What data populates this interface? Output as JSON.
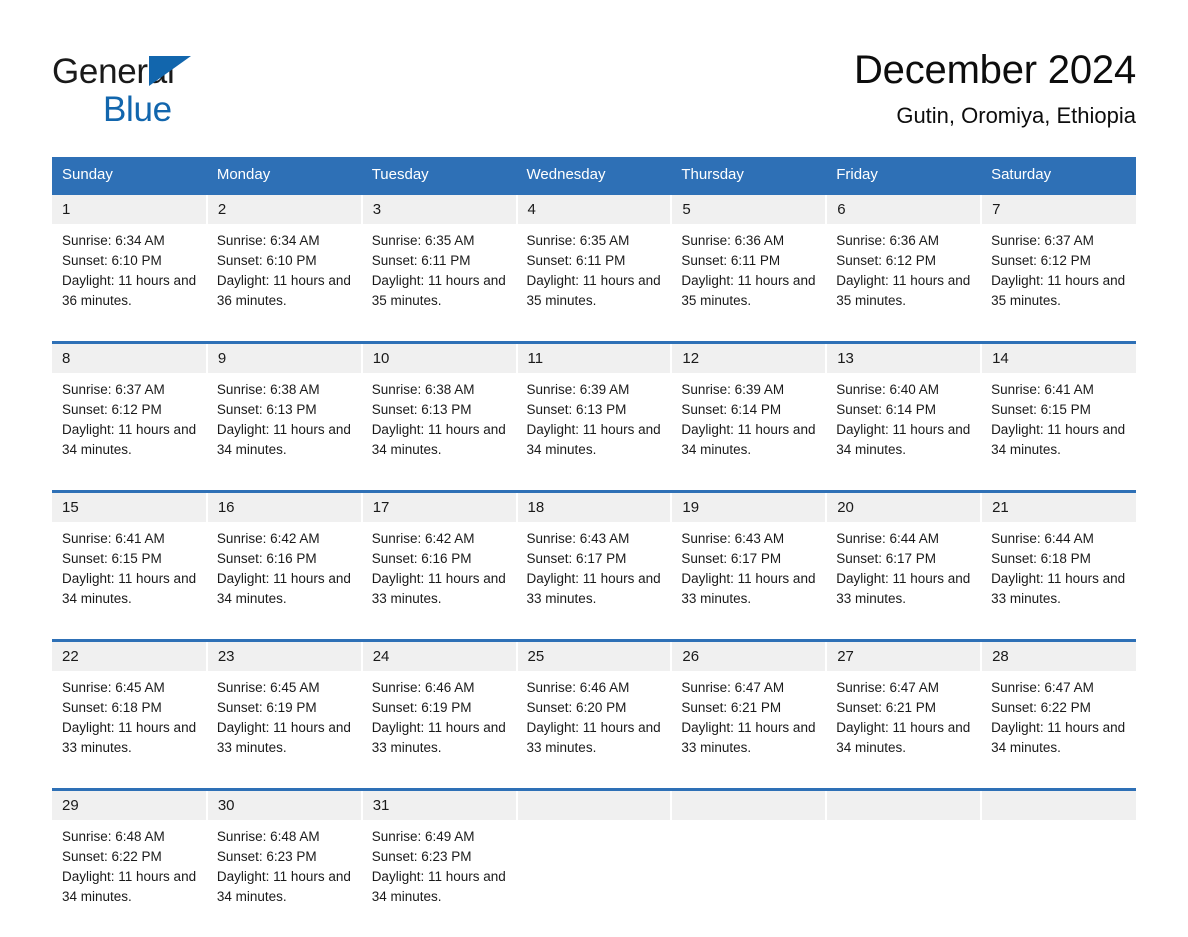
{
  "brand": {
    "name_part1": "General",
    "name_part2": "Blue",
    "triangle_color": "#1266ad",
    "blue_color": "#1266ad"
  },
  "header": {
    "title": "December 2024",
    "subtitle": "Gutin, Oromiya, Ethiopia"
  },
  "theme": {
    "header_blue": "#2e70b6",
    "row_rule_blue": "#2e70b6",
    "daynum_band": "#f0f0f0",
    "cell_background": "#ffffff"
  },
  "weekdays": [
    "Sunday",
    "Monday",
    "Tuesday",
    "Wednesday",
    "Thursday",
    "Friday",
    "Saturday"
  ],
  "weeks": [
    [
      {
        "day": "1",
        "sunrise": "Sunrise: 6:34 AM",
        "sunset": "Sunset: 6:10 PM",
        "daylight": "Daylight: 11 hours and 36 minutes."
      },
      {
        "day": "2",
        "sunrise": "Sunrise: 6:34 AM",
        "sunset": "Sunset: 6:10 PM",
        "daylight": "Daylight: 11 hours and 36 minutes."
      },
      {
        "day": "3",
        "sunrise": "Sunrise: 6:35 AM",
        "sunset": "Sunset: 6:11 PM",
        "daylight": "Daylight: 11 hours and 35 minutes."
      },
      {
        "day": "4",
        "sunrise": "Sunrise: 6:35 AM",
        "sunset": "Sunset: 6:11 PM",
        "daylight": "Daylight: 11 hours and 35 minutes."
      },
      {
        "day": "5",
        "sunrise": "Sunrise: 6:36 AM",
        "sunset": "Sunset: 6:11 PM",
        "daylight": "Daylight: 11 hours and 35 minutes."
      },
      {
        "day": "6",
        "sunrise": "Sunrise: 6:36 AM",
        "sunset": "Sunset: 6:12 PM",
        "daylight": "Daylight: 11 hours and 35 minutes."
      },
      {
        "day": "7",
        "sunrise": "Sunrise: 6:37 AM",
        "sunset": "Sunset: 6:12 PM",
        "daylight": "Daylight: 11 hours and 35 minutes."
      }
    ],
    [
      {
        "day": "8",
        "sunrise": "Sunrise: 6:37 AM",
        "sunset": "Sunset: 6:12 PM",
        "daylight": "Daylight: 11 hours and 34 minutes."
      },
      {
        "day": "9",
        "sunrise": "Sunrise: 6:38 AM",
        "sunset": "Sunset: 6:13 PM",
        "daylight": "Daylight: 11 hours and 34 minutes."
      },
      {
        "day": "10",
        "sunrise": "Sunrise: 6:38 AM",
        "sunset": "Sunset: 6:13 PM",
        "daylight": "Daylight: 11 hours and 34 minutes."
      },
      {
        "day": "11",
        "sunrise": "Sunrise: 6:39 AM",
        "sunset": "Sunset: 6:13 PM",
        "daylight": "Daylight: 11 hours and 34 minutes."
      },
      {
        "day": "12",
        "sunrise": "Sunrise: 6:39 AM",
        "sunset": "Sunset: 6:14 PM",
        "daylight": "Daylight: 11 hours and 34 minutes."
      },
      {
        "day": "13",
        "sunrise": "Sunrise: 6:40 AM",
        "sunset": "Sunset: 6:14 PM",
        "daylight": "Daylight: 11 hours and 34 minutes."
      },
      {
        "day": "14",
        "sunrise": "Sunrise: 6:41 AM",
        "sunset": "Sunset: 6:15 PM",
        "daylight": "Daylight: 11 hours and 34 minutes."
      }
    ],
    [
      {
        "day": "15",
        "sunrise": "Sunrise: 6:41 AM",
        "sunset": "Sunset: 6:15 PM",
        "daylight": "Daylight: 11 hours and 34 minutes."
      },
      {
        "day": "16",
        "sunrise": "Sunrise: 6:42 AM",
        "sunset": "Sunset: 6:16 PM",
        "daylight": "Daylight: 11 hours and 34 minutes."
      },
      {
        "day": "17",
        "sunrise": "Sunrise: 6:42 AM",
        "sunset": "Sunset: 6:16 PM",
        "daylight": "Daylight: 11 hours and 33 minutes."
      },
      {
        "day": "18",
        "sunrise": "Sunrise: 6:43 AM",
        "sunset": "Sunset: 6:17 PM",
        "daylight": "Daylight: 11 hours and 33 minutes."
      },
      {
        "day": "19",
        "sunrise": "Sunrise: 6:43 AM",
        "sunset": "Sunset: 6:17 PM",
        "daylight": "Daylight: 11 hours and 33 minutes."
      },
      {
        "day": "20",
        "sunrise": "Sunrise: 6:44 AM",
        "sunset": "Sunset: 6:17 PM",
        "daylight": "Daylight: 11 hours and 33 minutes."
      },
      {
        "day": "21",
        "sunrise": "Sunrise: 6:44 AM",
        "sunset": "Sunset: 6:18 PM",
        "daylight": "Daylight: 11 hours and 33 minutes."
      }
    ],
    [
      {
        "day": "22",
        "sunrise": "Sunrise: 6:45 AM",
        "sunset": "Sunset: 6:18 PM",
        "daylight": "Daylight: 11 hours and 33 minutes."
      },
      {
        "day": "23",
        "sunrise": "Sunrise: 6:45 AM",
        "sunset": "Sunset: 6:19 PM",
        "daylight": "Daylight: 11 hours and 33 minutes."
      },
      {
        "day": "24",
        "sunrise": "Sunrise: 6:46 AM",
        "sunset": "Sunset: 6:19 PM",
        "daylight": "Daylight: 11 hours and 33 minutes."
      },
      {
        "day": "25",
        "sunrise": "Sunrise: 6:46 AM",
        "sunset": "Sunset: 6:20 PM",
        "daylight": "Daylight: 11 hours and 33 minutes."
      },
      {
        "day": "26",
        "sunrise": "Sunrise: 6:47 AM",
        "sunset": "Sunset: 6:21 PM",
        "daylight": "Daylight: 11 hours and 33 minutes."
      },
      {
        "day": "27",
        "sunrise": "Sunrise: 6:47 AM",
        "sunset": "Sunset: 6:21 PM",
        "daylight": "Daylight: 11 hours and 34 minutes."
      },
      {
        "day": "28",
        "sunrise": "Sunrise: 6:47 AM",
        "sunset": "Sunset: 6:22 PM",
        "daylight": "Daylight: 11 hours and 34 minutes."
      }
    ],
    [
      {
        "day": "29",
        "sunrise": "Sunrise: 6:48 AM",
        "sunset": "Sunset: 6:22 PM",
        "daylight": "Daylight: 11 hours and 34 minutes."
      },
      {
        "day": "30",
        "sunrise": "Sunrise: 6:48 AM",
        "sunset": "Sunset: 6:23 PM",
        "daylight": "Daylight: 11 hours and 34 minutes."
      },
      {
        "day": "31",
        "sunrise": "Sunrise: 6:49 AM",
        "sunset": "Sunset: 6:23 PM",
        "daylight": "Daylight: 11 hours and 34 minutes."
      },
      {
        "day": "",
        "sunrise": "",
        "sunset": "",
        "daylight": ""
      },
      {
        "day": "",
        "sunrise": "",
        "sunset": "",
        "daylight": ""
      },
      {
        "day": "",
        "sunrise": "",
        "sunset": "",
        "daylight": ""
      },
      {
        "day": "",
        "sunrise": "",
        "sunset": "",
        "daylight": ""
      }
    ]
  ]
}
